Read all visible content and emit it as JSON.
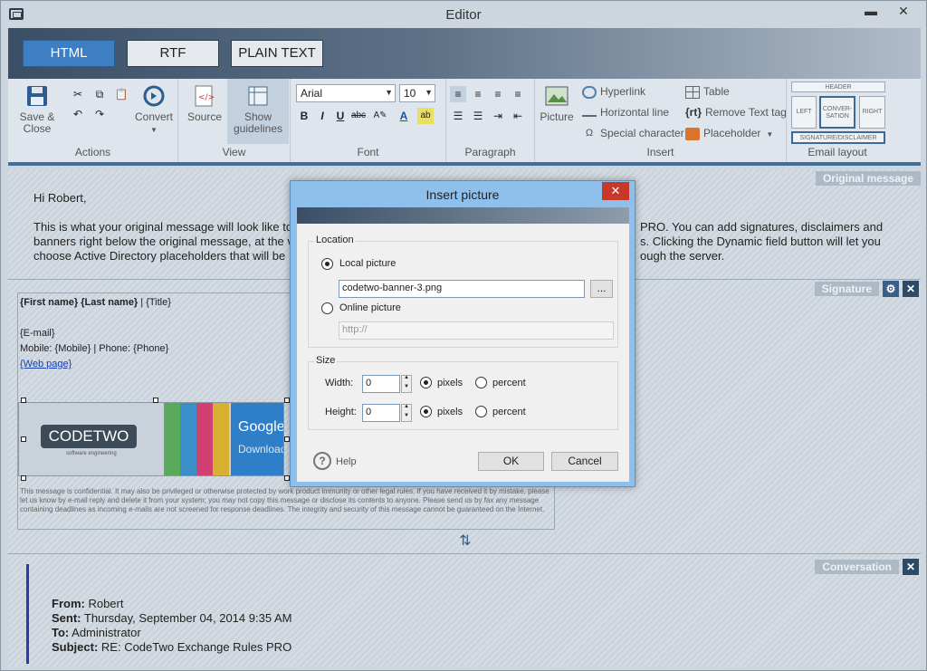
{
  "window": {
    "title": "Editor",
    "minimize": "▬",
    "close": "✕"
  },
  "format_tabs": [
    "HTML",
    "RTF",
    "PLAIN TEXT"
  ],
  "ribbon": {
    "actions": {
      "save_close": [
        "Save &",
        "Close"
      ],
      "convert": "Convert",
      "label": "Actions"
    },
    "view": {
      "source": "Source",
      "guidelines": [
        "Show",
        "guidelines"
      ],
      "label": "View"
    },
    "font": {
      "family": "Arial",
      "size": "10",
      "label": "Font"
    },
    "paragraph": {
      "label": "Paragraph"
    },
    "insert": {
      "picture": "Picture",
      "hyperlink": "Hyperlink",
      "hline": "Horizontal line",
      "special": "Special character",
      "table": "Table",
      "remove_tag": "Remove Text tag",
      "placeholder": "Placeholder",
      "label": "Insert"
    },
    "email_layout": {
      "header": "HEADER",
      "left": "LEFT",
      "conversation": "CONVER-SATION",
      "right": "RIGHT",
      "signature": "SIGNATURE/DISCLAIMER",
      "label": "Email layout"
    }
  },
  "sections": {
    "original": "Original message",
    "signature": "Signature",
    "conversation": "Conversation"
  },
  "message": {
    "greeting": "Hi Robert,",
    "line1_a": "This is what your original message will look like to",
    "line1_b": "PRO. You can add signatures, disclaimers and",
    "line2_a": "banners right below the original message, at the v",
    "line2_b": "s. Clicking the Dynamic field button will let you",
    "line3_a": "choose Active Directory placeholders that will be",
    "line3_b": "ough the server."
  },
  "signature": {
    "name_line": "{First name} {Last name}",
    "title": " | {Title}",
    "email": "{E-mail}",
    "phones": "Mobile: {Mobile} | Phone: {Phone}",
    "web": "{Web page}",
    "logo": "CODETWO",
    "logo_sub": "software engineering",
    "banner_g": "Google",
    "banner_d": "Download",
    "disclaimer": "This message is confidential. It may also be privileged or otherwise protected by work product immunity or other legal rules. If you have received it by mistake, please let us know by e-mail reply and delete it from your system; you may not copy this message or disclose its contents to anyone. Please send us by fax any message containing deadlines as incoming e-mails are not screened for response deadlines. The integrity and security of this message cannot be guaranteed on the Internet."
  },
  "conversation": {
    "from_l": "From:",
    "from_v": " Robert",
    "sent_l": "Sent:",
    "sent_v": " Thursday, September 04, 2014 9:35 AM",
    "to_l": "To:",
    "to_v": " Administrator",
    "subj_l": "Subject:",
    "subj_v": " RE: CodeTwo Exchange Rules PRO"
  },
  "dialog": {
    "title": "Insert picture",
    "location": "Location",
    "local": "Local picture",
    "local_value": "codetwo-banner-3.png",
    "browse": "...",
    "online": "Online picture",
    "online_placeholder": "http://",
    "size": "Size",
    "width": "Width:",
    "height": "Height:",
    "width_value": "0",
    "height_value": "0",
    "pixels": "pixels",
    "percent": "percent",
    "help": "Help",
    "ok": "OK",
    "cancel": "Cancel"
  },
  "colors": {
    "accent": "#3d7fc2",
    "dialog_frame": "#8fc0ec",
    "close": "#c7382b"
  }
}
